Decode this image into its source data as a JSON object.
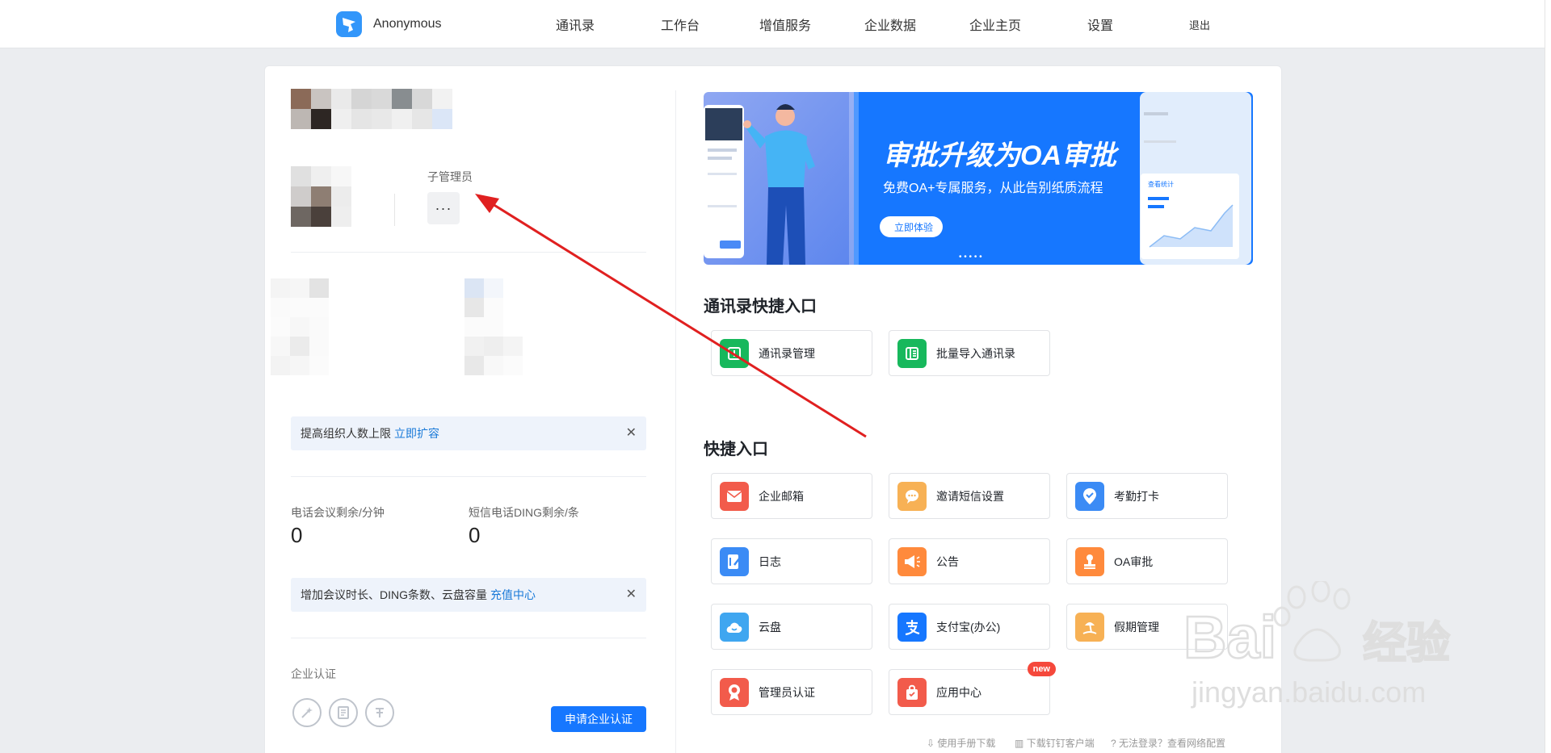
{
  "topbar": {
    "brand_name": "Anonymous",
    "nav": [
      "通讯录",
      "工作台",
      "增值服务",
      "企业数据",
      "企业主页",
      "设置"
    ],
    "logout": "退出"
  },
  "profile": {
    "role_label": "子管理员",
    "more_label": "···"
  },
  "tips": {
    "expand_text": "提高组织人数上限",
    "expand_link": "立即扩容",
    "recharge_text": "增加会议时长、DING条数、云盘容量",
    "recharge_link": "充值中心",
    "close": "✕"
  },
  "stats": [
    {
      "label": "电话会议剩余/分钟",
      "value": "0"
    },
    {
      "label": "短信电话DING剩余/条",
      "value": "0"
    }
  ],
  "certification": {
    "title": "企业认证",
    "button": "申请企业认证"
  },
  "banner": {
    "headline": "审批升级为OA审批",
    "subline": "免费OA+专属服务，从此告别纸质流程",
    "cta": "立即体验",
    "card_title": "查看统计",
    "page_dots": "• • • • •"
  },
  "contacts_section": {
    "title": "通讯录快捷入口",
    "tiles": [
      {
        "label": "通讯录管理",
        "icon": "contacts-icon",
        "color": "#17b85c"
      },
      {
        "label": "批量导入通讯录",
        "icon": "import-icon",
        "color": "#17b85c"
      }
    ]
  },
  "quick_section": {
    "title": "快捷入口",
    "tiles": [
      {
        "label": "企业邮箱",
        "icon": "mail-icon",
        "color": "#f25b4b"
      },
      {
        "label": "邀请短信设置",
        "icon": "sms-icon",
        "color": "#f7b155"
      },
      {
        "label": "考勤打卡",
        "icon": "location-icon",
        "color": "#3b8bf5"
      },
      {
        "label": "日志",
        "icon": "log-icon",
        "color": "#3b8bf5"
      },
      {
        "label": "公告",
        "icon": "megaphone-icon",
        "color": "#ff8a3c"
      },
      {
        "label": "OA审批",
        "icon": "stamp-icon",
        "color": "#ff8a3c"
      },
      {
        "label": "云盘",
        "icon": "cloud-icon",
        "color": "#3fa6f0"
      },
      {
        "label": "支付宝(办公)",
        "icon": "alipay-icon",
        "color": "#1677ff"
      },
      {
        "label": "假期管理",
        "icon": "beach-icon",
        "color": "#f7b155"
      },
      {
        "label": "管理员认证",
        "icon": "badge-icon",
        "color": "#f25b4b"
      },
      {
        "label": "应用中心",
        "icon": "bag-icon",
        "color": "#f25b4b",
        "badge": "new"
      }
    ]
  },
  "footer": [
    {
      "label": "使用手册下载",
      "icon": "download-icon"
    },
    {
      "label": "下载钉钉客户端",
      "icon": "client-icon"
    },
    {
      "label": "无法登录？查看网络配置",
      "icon": "help-icon"
    }
  ],
  "watermark": {
    "brand": "Bai",
    "brand2": "经验",
    "url": "jingyan.baidu.com"
  }
}
